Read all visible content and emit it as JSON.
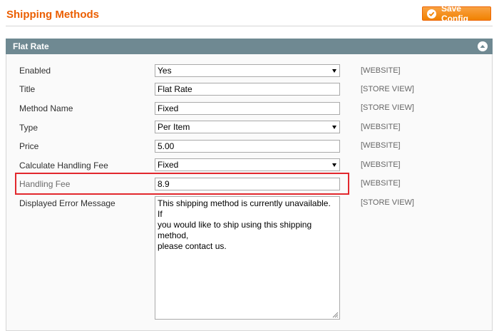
{
  "page": {
    "title": "Shipping Methods",
    "save_label": "Save Config",
    "save_icon": "check-circle-icon",
    "accent": "#eb5e00"
  },
  "section": {
    "title": "Flat Rate",
    "collapse_icon": "chevron-up-icon"
  },
  "fields": {
    "enabled": {
      "label": "Enabled",
      "value": "Yes",
      "scope": "[WEBSITE]"
    },
    "title": {
      "label": "Title",
      "value": "Flat Rate",
      "scope": "[STORE VIEW]"
    },
    "method_name": {
      "label": "Method Name",
      "value": "Fixed",
      "scope": "[STORE VIEW]"
    },
    "type": {
      "label": "Type",
      "value": "Per Item",
      "scope": "[WEBSITE]"
    },
    "price": {
      "label": "Price",
      "value": "5.00",
      "scope": "[WEBSITE]"
    },
    "calc_handling_fee": {
      "label": "Calculate Handling Fee",
      "value": "Fixed",
      "scope": "[WEBSITE]"
    },
    "handling_fee": {
      "label": "Handling Fee",
      "value": "8.9",
      "scope": "[WEBSITE]"
    },
    "error_message": {
      "label": "Displayed Error Message",
      "value": "This shipping method is currently unavailable. If\nyou would like to ship using this shipping method,\nplease contact us.",
      "scope": "[STORE VIEW]"
    }
  },
  "highlight_color": "#e2282d"
}
